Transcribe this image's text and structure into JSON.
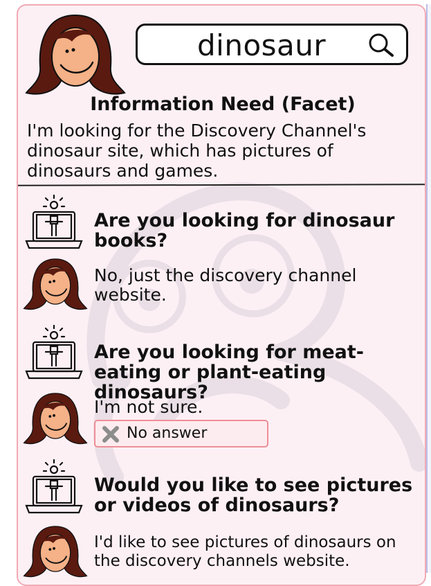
{
  "search": {
    "query": "dinosaur",
    "icon": "search-icon"
  },
  "information_need": {
    "title": "Information Need (Facet)",
    "text": "I'm looking for the Discovery Channel's dinosaur site, which has pictures of dinosaurs and games."
  },
  "conversation": [
    {
      "question": "Are you looking for dinosaur books?",
      "answer": "No, just the discovery channel website."
    },
    {
      "question": "Are you looking for meat-eating or plant-eating dinosaurs?",
      "answer": "I'm not sure.",
      "badge": "No answer"
    },
    {
      "question": "Would you like to see pictures or videos of dinosaurs?",
      "answer": "I'd like to see pictures of dinosaurs on the discovery channels website."
    }
  ],
  "colors": {
    "card_background": "#fdf0f5",
    "card_border": "#f1a9b4",
    "badge_border": "#ee8e97",
    "hair": "#5a1a10",
    "skin": "#f5b187"
  }
}
